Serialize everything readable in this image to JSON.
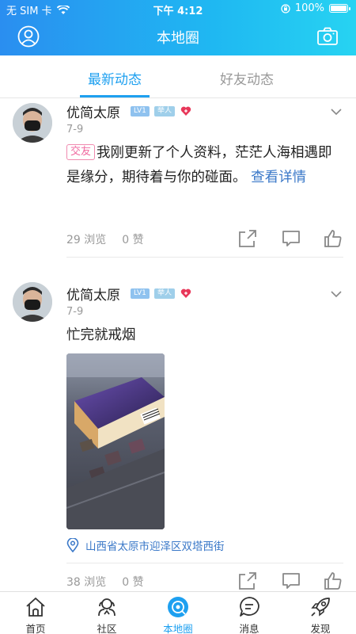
{
  "status": {
    "carrier": "无 SIM 卡",
    "time": "下午 4:12",
    "battery": "100%"
  },
  "nav": {
    "title": "本地圈"
  },
  "tabs": [
    {
      "label": "最新动态",
      "active": true
    },
    {
      "label": "好友动态",
      "active": false
    }
  ],
  "posts": [
    {
      "username": "优简太原",
      "level": "LV1",
      "badge": "举人",
      "date": "7-9",
      "tag": "交友",
      "text": "我刚更新了个人资料，茫茫人海相遇即是缘分，期待着与你的碰面。",
      "more_link": "查看详情",
      "views": "29 浏览",
      "likes": "0 赞"
    },
    {
      "username": "优简太原",
      "level": "LV1",
      "badge": "举人",
      "date": "7-9",
      "text": "忙完就戒烟",
      "location": "山西省太原市迎泽区双塔西街",
      "views": "38 浏览",
      "likes": "0 赞"
    }
  ],
  "tabbar": [
    {
      "label": "首页",
      "icon": "home-icon"
    },
    {
      "label": "社区",
      "icon": "community-icon"
    },
    {
      "label": "本地圈",
      "icon": "local-circle-icon",
      "active": true
    },
    {
      "label": "消息",
      "icon": "message-icon"
    },
    {
      "label": "发现",
      "icon": "rocket-icon"
    }
  ],
  "colors": {
    "accent": "#1ea0f0",
    "header_start": "#2a8ef0",
    "header_end": "#27d3f2",
    "link": "#3a78c8",
    "tag_pink": "#f06aa0"
  }
}
